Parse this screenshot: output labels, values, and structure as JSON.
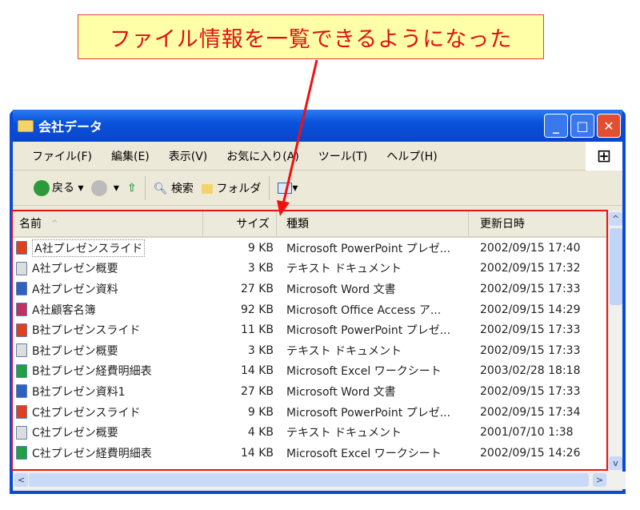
{
  "callout": "ファイル情報を一覧できるようになった",
  "window": {
    "title": "会社データ"
  },
  "menu": [
    "ファイル(F)",
    "編集(E)",
    "表示(V)",
    "お気に入り(A)",
    "ツール(T)",
    "ヘルプ(H)"
  ],
  "toolbar": {
    "back": "戻る",
    "search": "検索",
    "folders": "フォルダ"
  },
  "columns": [
    "名前",
    "サイズ",
    "種類",
    "更新日時"
  ],
  "colors": {
    "highlight": "#f01010",
    "callout_bg": "#ffffa8",
    "title_bar": "#0a52dc"
  },
  "files": [
    {
      "name": "A社プレゼンスライド",
      "size": "9 KB",
      "type": "Microsoft PowerPoint プレゼ...",
      "date": "2002/09/15 17:40",
      "icon": "ppt"
    },
    {
      "name": "A社プレゼン概要",
      "size": "3 KB",
      "type": "テキスト ドキュメント",
      "date": "2002/09/15 17:32",
      "icon": "txt"
    },
    {
      "name": "A社プレゼン資料",
      "size": "27 KB",
      "type": "Microsoft Word 文書",
      "date": "2002/09/15 17:33",
      "icon": "doc"
    },
    {
      "name": "A社顧客名簿",
      "size": "92 KB",
      "type": "Microsoft Office Access ア...",
      "date": "2002/09/15 14:29",
      "icon": "mdb"
    },
    {
      "name": "B社プレゼンスライド",
      "size": "11 KB",
      "type": "Microsoft PowerPoint プレゼ...",
      "date": "2002/09/15 17:33",
      "icon": "ppt"
    },
    {
      "name": "B社プレゼン概要",
      "size": "3 KB",
      "type": "テキスト ドキュメント",
      "date": "2002/09/15 17:33",
      "icon": "txt"
    },
    {
      "name": "B社プレゼン経費明細表",
      "size": "14 KB",
      "type": "Microsoft Excel ワークシート",
      "date": "2003/02/28 18:18",
      "icon": "xls"
    },
    {
      "name": "B社プレゼン資料1",
      "size": "27 KB",
      "type": "Microsoft Word 文書",
      "date": "2002/09/15 17:33",
      "icon": "doc"
    },
    {
      "name": "C社プレゼンスライド",
      "size": "9 KB",
      "type": "Microsoft PowerPoint プレゼ...",
      "date": "2002/09/15 17:34",
      "icon": "ppt"
    },
    {
      "name": "C社プレゼン概要",
      "size": "4 KB",
      "type": "テキスト ドキュメント",
      "date": "2001/07/10 1:38",
      "icon": "txt"
    },
    {
      "name": "C社プレゼン経費明細表",
      "size": "14 KB",
      "type": "Microsoft Excel ワークシート",
      "date": "2002/09/15 14:26",
      "icon": "xls"
    }
  ]
}
